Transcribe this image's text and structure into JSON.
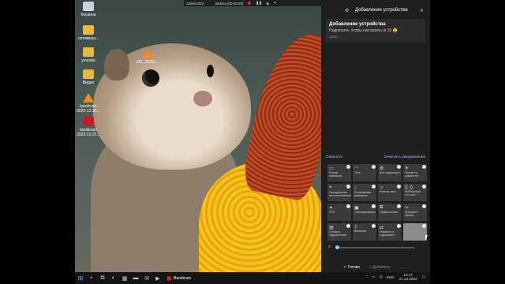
{
  "recorder": {
    "resolution": "1280x1024",
    "status": "Запись [00:00:25]"
  },
  "desktop": {
    "icons": [
      {
        "label": "Корзина",
        "icon": "recycle-bin-icon"
      },
      {
        "label": "оптимиза...",
        "icon": "folder-icon"
      },
      {
        "label": "youtube",
        "icon": "folder-icon"
      },
      {
        "label": "Видео",
        "icon": "folder-icon"
      },
      {
        "label": "bandicam 2022-12-21...",
        "icon": "vlc-icon"
      },
      {
        "label": "bandicam 2022-12-21...",
        "icon": "bandicam-icon"
      },
      {
        "label": "VID_20221...",
        "icon": "vlc-icon"
      }
    ]
  },
  "panel": {
    "title": "Добавление устройства",
    "notification": {
      "title": "Добавление устройства",
      "body": "Поднесите, чтобы настроить nt 10 😮",
      "time": "1658"
    },
    "collapse": "Свернуть",
    "clear": "Очистить уведомления",
    "tiles": [
      {
        "label": "Режим планшета",
        "icon": "tablet-icon"
      },
      {
        "label": "Сеть",
        "icon": "network-icon"
      },
      {
        "label": "Все параметры",
        "icon": "settings-icon"
      },
      {
        "label": "Режим «в самолете»",
        "icon": "airplane-icon"
      },
      {
        "label": "Определение местоположения",
        "icon": "location-icon"
      },
      {
        "label": "Фокусировка внимания",
        "icon": "moon-icon"
      },
      {
        "label": "Ночной свет",
        "icon": "sun-icon"
      },
      {
        "label": "Мобильный хот-спот",
        "icon": "hotspot-icon"
      },
      {
        "label": "VPN",
        "icon": "vpn-icon"
      },
      {
        "label": "Проецирование",
        "icon": "project-icon"
      },
      {
        "label": "Подключение",
        "icon": "connect-icon"
      },
      {
        "label": "Фрагмент экрана",
        "icon": "snip-icon"
      },
      {
        "label": "Сетевое подключение",
        "icon": "ethernet-icon"
      },
      {
        "label": "Bluetooth",
        "icon": "bluetooth-icon"
      },
      {
        "label": "Нажмите и подключите",
        "icon": "nearby-icon"
      },
      {
        "label": "",
        "icon": "blank-icon"
      }
    ],
    "done": "Готово",
    "add": "Добавить",
    "more": "..."
  },
  "taskbar": {
    "app": "Bandicam",
    "language": "ENG",
    "time": "12:17",
    "date": "21.12.2022"
  }
}
